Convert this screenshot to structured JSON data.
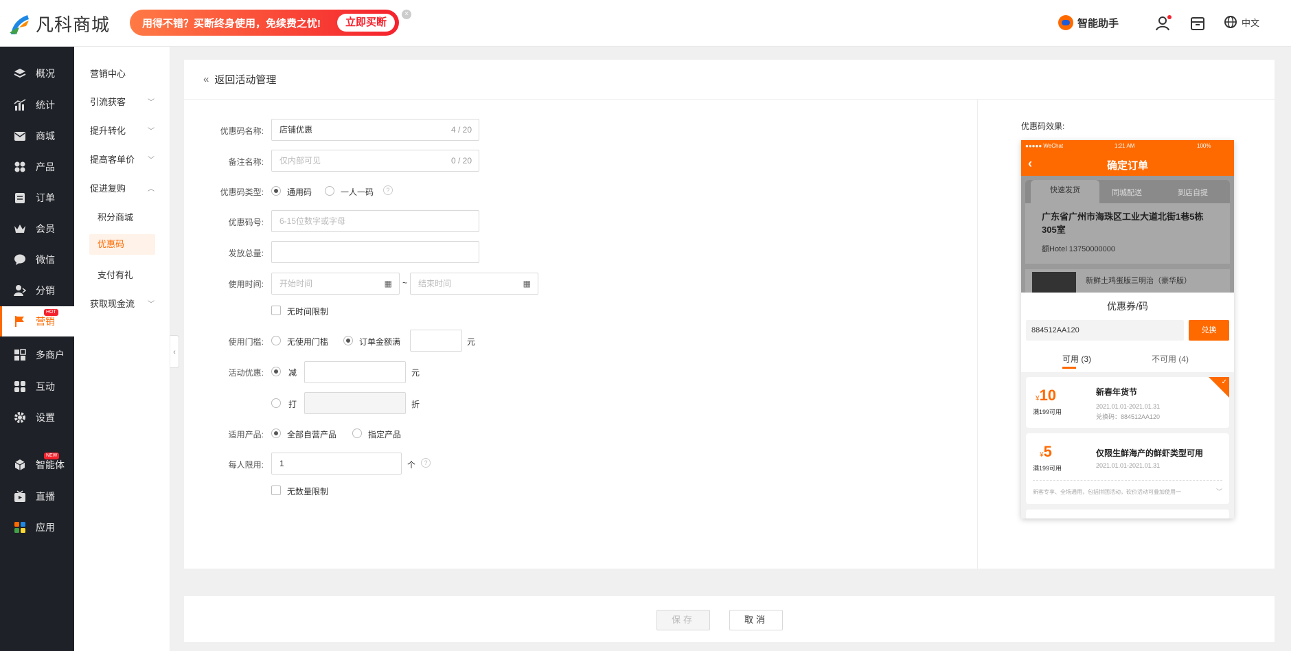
{
  "header": {
    "logo_text": "凡科商城",
    "promo_text": "用得不错？买断终身使用，免续费之忧!",
    "promo_button": "立即买断",
    "promo_close": "×",
    "assistant": "智能助手",
    "language": "中文"
  },
  "sidebar": {
    "items": [
      {
        "label": "概况",
        "icon": "layers-icon"
      },
      {
        "label": "统计",
        "icon": "chart-icon"
      },
      {
        "label": "商城",
        "icon": "mail-icon"
      },
      {
        "label": "产品",
        "icon": "grid-icon"
      },
      {
        "label": "订单",
        "icon": "order-icon"
      },
      {
        "label": "会员",
        "icon": "crown-icon"
      },
      {
        "label": "微信",
        "icon": "wechat-icon"
      },
      {
        "label": "分销",
        "icon": "user-share-icon"
      },
      {
        "label": "营销",
        "icon": "flag-icon",
        "badge": "HOT"
      },
      {
        "label": "多商户",
        "icon": "store-icon"
      },
      {
        "label": "互动",
        "icon": "apps-icon"
      },
      {
        "label": "设置",
        "icon": "gear-icon"
      },
      {
        "label": "智能体",
        "icon": "cube-icon",
        "badge": "NEW"
      },
      {
        "label": "直播",
        "icon": "tv-icon"
      },
      {
        "label": "应用",
        "icon": "apps-color-icon"
      }
    ]
  },
  "submenu": {
    "center": "营销中心",
    "groups": [
      "引流获客",
      "提升转化",
      "提高客单价",
      "促进复购",
      "获取现金流"
    ],
    "items": [
      "积分商城",
      "优惠码",
      "支付有礼"
    ]
  },
  "form": {
    "back_label": "返回活动管理",
    "name_label": "优惠码名称:",
    "name_value": "店铺优惠",
    "name_count": "4 / 20",
    "remark_label": "备注名称:",
    "remark_placeholder": "仅内部可见",
    "remark_count": "0 / 20",
    "type_label": "优惠码类型:",
    "type_opt1": "通用码",
    "type_opt2": "一人一码",
    "code_label": "优惠码号:",
    "code_placeholder": "6-15位数字或字母",
    "total_label": "发放总量:",
    "time_label": "使用时间:",
    "start_placeholder": "开始时间",
    "end_placeholder": "结束时间",
    "tilde": "~",
    "no_time_limit": "无时间限制",
    "threshold_label": "使用门槛:",
    "threshold_opt1": "无使用门槛",
    "threshold_opt2": "订单金额满",
    "yuan": "元",
    "discount_label": "活动优惠:",
    "discount_minus": "减",
    "discount_off": "打",
    "zhe": "折",
    "products_label": "适用产品:",
    "products_opt1": "全部自营产品",
    "products_opt2": "指定产品",
    "limit_label": "每人限用:",
    "limit_value": "1",
    "ge": "个",
    "no_qty_limit": "无数量限制",
    "help": "?"
  },
  "preview": {
    "title": "优惠码效果:",
    "status_left": "●●●●● WeChat",
    "status_time": "1:21 AM",
    "status_right": "100%",
    "page_title": "确定订单",
    "tabs": [
      "快速发货",
      "同城配送",
      "到店自提"
    ],
    "address": "广东省广州市海珠区工业大道北街1巷5栋305室",
    "contact": "额Hotel  13750000000",
    "goods": "新鲜土鸡蛋版三明治（豪华版）",
    "sheet_title": "优惠券/码",
    "code_value": "884512AA120",
    "redeem": "兑换",
    "tab_available": "可用 (3)",
    "tab_unavailable": "不可用 (4)",
    "coupons": [
      {
        "currency": "¥",
        "amount": "10",
        "cond": "满199可用",
        "name": "新春年货节",
        "date": "2021.01.01-2021.01.31",
        "code": "兑换码：884512AA120"
      },
      {
        "currency": "¥",
        "amount": "5",
        "cond": "满199可用",
        "name": "仅限生鲜海产的鲜虾类型可用",
        "date": "2021.01.01-2021.01.31",
        "note": "新客专享、全场通用，包括拼团活动，砍价活动可叠加使用一"
      }
    ]
  },
  "footer": {
    "save": "保存",
    "cancel": "取消"
  },
  "colors": {
    "accent": "#ff6a00",
    "sidebar_bg": "#1e2128",
    "promo": "#f5222d"
  }
}
